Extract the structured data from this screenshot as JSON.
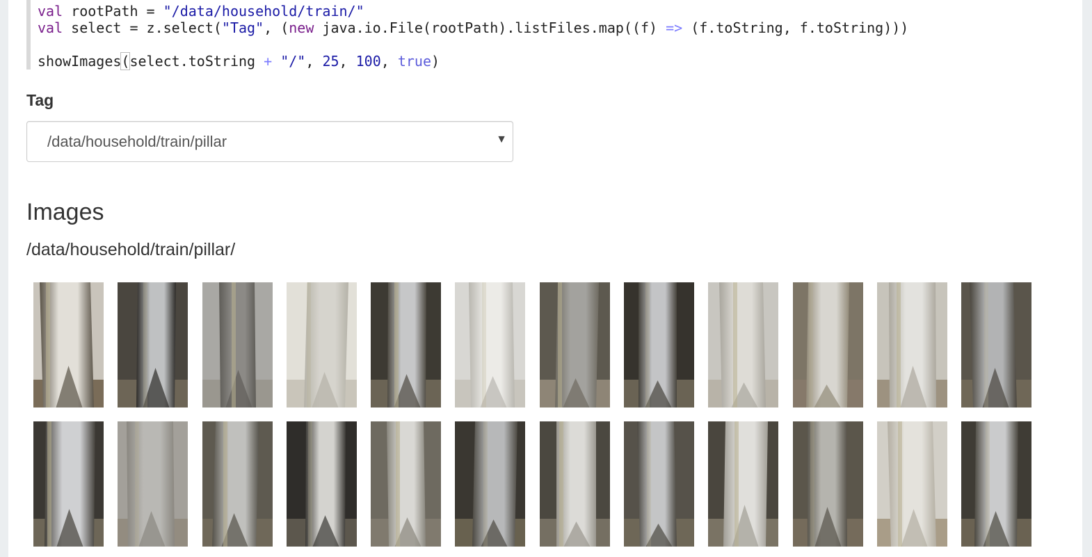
{
  "code": {
    "line1": {
      "kw": "val",
      "name": " rootPath ",
      "op": "=",
      "sp": " ",
      "str": "\"/data/household/train/\""
    },
    "line2": {
      "kw": "val",
      "a": " select ",
      "op": "=",
      "b": " z.select(",
      "str": "\"Tag\"",
      "c": ", (",
      "kw2": "new",
      "d": " java.io.File(rootPath).listFiles.map((f) ",
      "arrow": "=>",
      "e": " (f.toString, f.toString)))"
    },
    "line4": {
      "a": "showImages",
      "bracket": "(",
      "b": "select.toString ",
      "op": "+",
      "sp": " ",
      "str": "\"/\"",
      "c": ", ",
      "n1": "25",
      "d": ", ",
      "n2": "100",
      "e": ", ",
      "atom": "true",
      "f": ")"
    }
  },
  "form": {
    "tag_label": "Tag",
    "select_value": "/data/household/train/pillar",
    "caret": "▼"
  },
  "output": {
    "title": "Images",
    "path": "/data/household/train/pillar/"
  },
  "thumbnails": [
    {
      "bg": "#c9c4bb",
      "pillar": "#e2dfd8",
      "shade": "#5b5448",
      "floor": "#7a6c58"
    },
    {
      "bg": "#4a463f",
      "pillar": "#bfc1c2",
      "shade": "#2e2c29",
      "floor": "#6d6556"
    },
    {
      "bg": "#a9a8a4",
      "pillar": "#8c8a86",
      "shade": "#5f5d58",
      "floor": "#9a978f"
    },
    {
      "bg": "#e2e0d8",
      "pillar": "#d6d4cd",
      "shade": "#b5b2a8",
      "floor": "#c9c5ba"
    },
    {
      "bg": "#3d3a33",
      "pillar": "#c6c7c8",
      "shade": "#4e4a42",
      "floor": "#6b6455"
    },
    {
      "bg": "#d8d7d3",
      "pillar": "#ecebe7",
      "shade": "#b9b7b0",
      "floor": "#c8c5bd"
    },
    {
      "bg": "#5d594f",
      "pillar": "#a3a29e",
      "shade": "#6f6b61",
      "floor": "#8e8576"
    },
    {
      "bg": "#36332d",
      "pillar": "#c3c4c6",
      "shade": "#47443d",
      "floor": "#6a6354"
    },
    {
      "bg": "#c8c6c0",
      "pillar": "#dedcd6",
      "shade": "#a9a69e",
      "floor": "#b8b3a8"
    },
    {
      "bg": "#7d7566",
      "pillar": "#d8d6d0",
      "shade": "#938b79",
      "floor": "#86796a"
    },
    {
      "bg": "#c7c4bb",
      "pillar": "#e3e2de",
      "shade": "#aca89e",
      "floor": "#9d9280"
    },
    {
      "bg": "#5a554b",
      "pillar": "#b2b3b4",
      "shade": "#4a463e",
      "floor": "#6f6757"
    },
    {
      "bg": "#3b3833",
      "pillar": "#cfd0d2",
      "shade": "#44413b",
      "floor": "#6d6657"
    },
    {
      "bg": "#a3a09a",
      "pillar": "#b9b8b4",
      "shade": "#8a8780",
      "floor": "#938c80"
    },
    {
      "bg": "#5e5a50",
      "pillar": "#c0c0bd",
      "shade": "#55524a",
      "floor": "#6f6859"
    },
    {
      "bg": "#2f2d2a",
      "pillar": "#d4d3cf",
      "shade": "#3c3a36",
      "floor": "#5c574d"
    },
    {
      "bg": "#6e6a60",
      "pillar": "#d9d8d4",
      "shade": "#8a877e",
      "floor": "#807a6e"
    },
    {
      "bg": "#3a3731",
      "pillar": "#b7b8b9",
      "shade": "#4c4942",
      "floor": "#68614f"
    },
    {
      "bg": "#4b4840",
      "pillar": "#dcdbd7",
      "shade": "#9a978f",
      "floor": "#756f62"
    },
    {
      "bg": "#56524a",
      "pillar": "#c4c5c6",
      "shade": "#4b4841",
      "floor": "#6e6757"
    },
    {
      "bg": "#4a463e",
      "pillar": "#e0dfdb",
      "shade": "#a19e96",
      "floor": "#7a7364"
    },
    {
      "bg": "#5b564b",
      "pillar": "#b5b4ae",
      "shade": "#57534a",
      "floor": "#756b5b"
    },
    {
      "bg": "#d2cfc7",
      "pillar": "#e4e2dc",
      "shade": "#b4afa3",
      "floor": "#a99d88"
    },
    {
      "bg": "#3f3c35",
      "pillar": "#cacbcc",
      "shade": "#4b4840",
      "floor": "#6a6252"
    }
  ]
}
